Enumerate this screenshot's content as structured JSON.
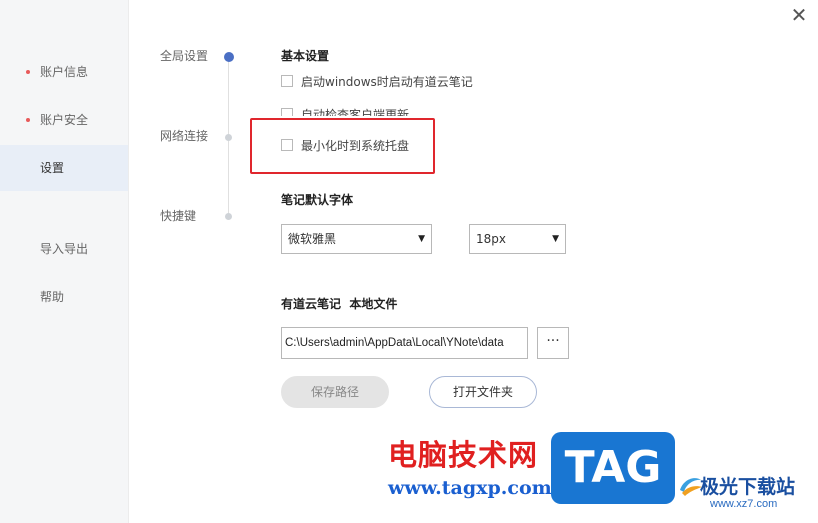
{
  "sidebar": {
    "items": [
      {
        "label": "账户信息",
        "dot": true
      },
      {
        "label": "账户安全",
        "dot": true
      },
      {
        "label": "设置",
        "active": true
      },
      {
        "label": "导入导出"
      },
      {
        "label": "帮助"
      }
    ]
  },
  "window": {
    "close_symbol": "✕"
  },
  "nav": {
    "items": [
      {
        "label": "全局设置",
        "active": true
      },
      {
        "label": "网络连接"
      },
      {
        "label": "快捷键"
      }
    ]
  },
  "basic": {
    "title": "基本设置",
    "options": [
      {
        "label": "启动windows时启动有道云笔记",
        "checked": false
      },
      {
        "label": "自动检查客户端更新",
        "checked": false
      },
      {
        "label": "最小化时到系统托盘",
        "checked": false
      }
    ]
  },
  "font": {
    "title": "笔记默认字体",
    "family_value": "微软雅黑",
    "size_value": "18px",
    "arrow_symbol": "▼"
  },
  "storage": {
    "title": "有道云笔记  本地文件",
    "path_value": "C:\\Users\\admin\\AppData\\Local\\YNote\\data",
    "browse_label": "···",
    "save_label": "保存路径",
    "open_label": "打开文件夹"
  },
  "watermark": {
    "brand_cn": "电脑技术网",
    "brand_url": "www.tagxp.com",
    "tag_text": "TAG",
    "site_cn": "极光下载站",
    "site_url": "www.xz7.com"
  },
  "colors": {
    "accent": "#4a6fc4",
    "highlight_border": "#e0262d",
    "sidebar_bg": "#f5f6f7",
    "sidebar_active": "#e8eef7"
  }
}
